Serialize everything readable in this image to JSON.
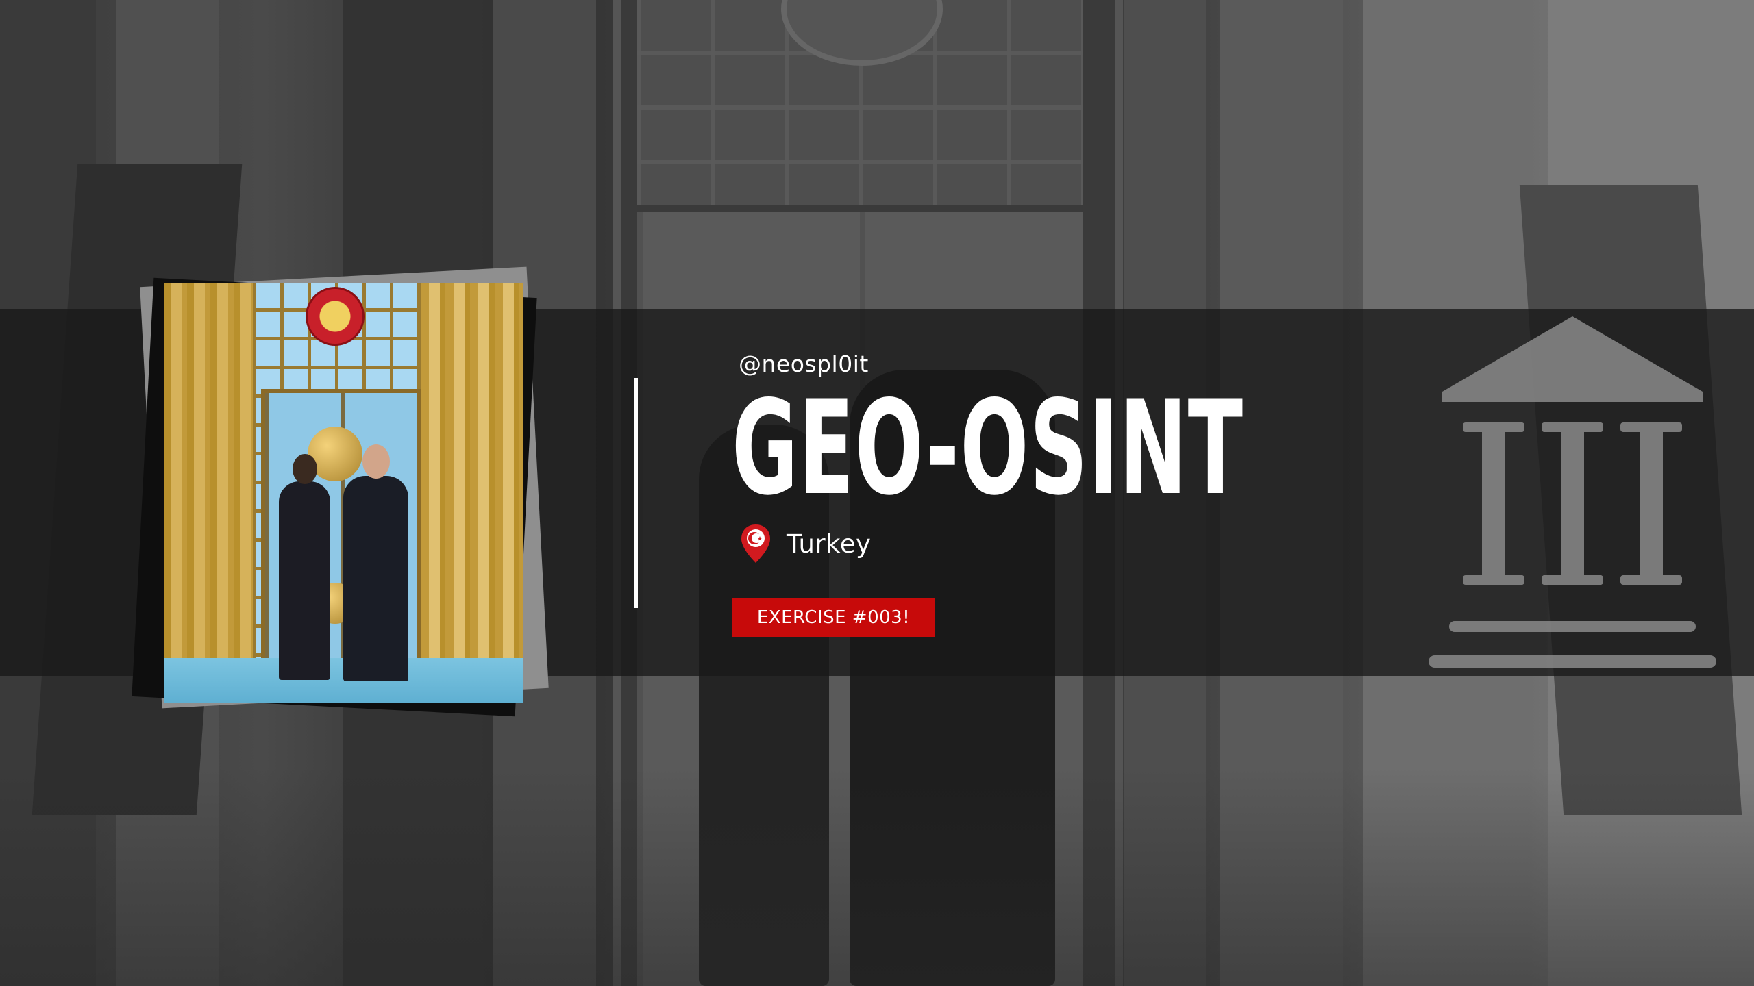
{
  "banner": {
    "handle": "@neospl0it",
    "title": "GEO-OSINT",
    "location": "Turkey",
    "badge": "EXERCISE #003!"
  },
  "icons": {
    "location": "map-pin-turkey-flag-icon",
    "institution": "government-building-icon"
  },
  "colors": {
    "accent": "#c70a0a",
    "band": "#181818",
    "text": "#ffffff"
  }
}
